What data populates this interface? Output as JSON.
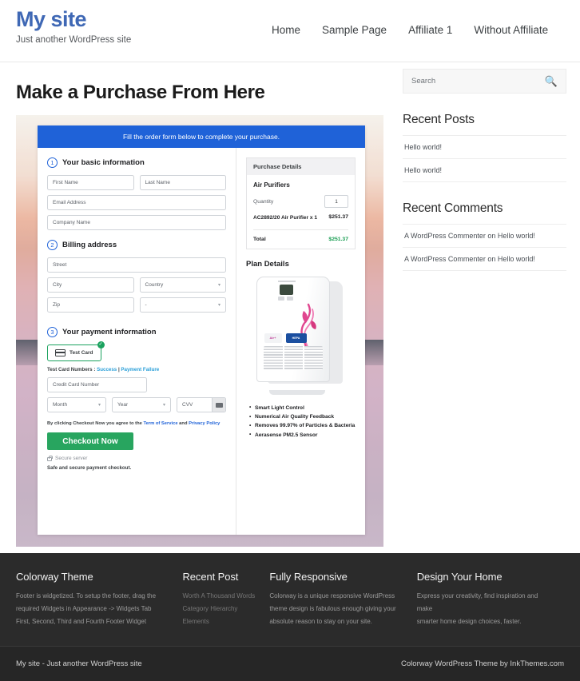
{
  "header": {
    "site_title": "My site",
    "tagline": "Just another WordPress site",
    "nav": [
      {
        "label": "Home"
      },
      {
        "label": "Sample Page"
      },
      {
        "label": "Affiliate 1"
      },
      {
        "label": "Without Affiliate"
      }
    ]
  },
  "main": {
    "page_title": "Make a Purchase From Here",
    "form": {
      "banner": "Fill the order form below to complete your purchase.",
      "step1": {
        "number": "1",
        "title": "Your basic information",
        "first_name_placeholder": "First Name",
        "last_name_placeholder": "Last Name",
        "email_placeholder": "Email Address",
        "company_placeholder": "Company Name"
      },
      "step2": {
        "number": "2",
        "title": "Billing address",
        "street_placeholder": "Street",
        "city_placeholder": "City",
        "country_value": "Country",
        "zip_placeholder": "Zip",
        "state_value": "-"
      },
      "step3": {
        "number": "3",
        "title": "Your payment information",
        "card_tab_label": "Test Card",
        "card_tab_check": "✓",
        "test_card_prefix": "Test Card Numbers : ",
        "test_card_success": "Success",
        "test_card_separator": " | ",
        "test_card_failure": "Payment Failure",
        "card_number_placeholder": "Credit Card Number",
        "month_value": "Month",
        "year_value": "Year",
        "cvv_placeholder": "CVV",
        "terms_prefix": "By clicking Checkout Now you agree to the ",
        "terms_link1": "Term of Service",
        "terms_middle": " and ",
        "terms_link2": "Privacy Policy",
        "checkout_label": "Checkout Now",
        "secure_server": "Secure server",
        "safe_text": "Safe and secure payment checkout."
      },
      "purchase_details": {
        "heading": "Purchase Details",
        "product": "Air Purifiers",
        "quantity_label": "Quantity",
        "quantity_value": "1",
        "line_item_name": "AC2892/20 Air Purifier x 1",
        "line_item_amount": "$251.37",
        "total_label": "Total",
        "total_amount": "$251.37"
      },
      "plan_details": {
        "heading": "Plan Details",
        "product_badge_1": "Air+",
        "product_badge_2": "HEPA",
        "features": [
          "Smart Light Control",
          "Numerical Air Quality Feedback",
          "Removes 99.97% of Particles & Bacteria",
          "Aerasense PM2.5 Sensor"
        ]
      }
    }
  },
  "sidebar": {
    "search_placeholder": "Search",
    "search_icon": "search-icon",
    "recent_posts": {
      "title": "Recent Posts",
      "items": [
        "Hello world!",
        "Hello world!"
      ]
    },
    "recent_comments": {
      "title": "Recent Comments",
      "items": [
        "A WordPress Commenter on Hello world!",
        "A WordPress Commenter on Hello world!"
      ]
    }
  },
  "footer": {
    "columns": [
      {
        "title": "Colorway Theme",
        "lines": [
          "Footer is widgetized. To setup the footer, drag the",
          "required Widgets in Appearance -> Widgets Tab",
          "First, Second, Third and Fourth Footer Widget"
        ]
      },
      {
        "title": "Recent Post",
        "lines": [
          "Worth A Thousand Words",
          "Category Hierarchy",
          "Elements"
        ]
      },
      {
        "title": "Fully Responsive",
        "lines": [
          "Colorway is a unique responsive WordPress",
          "theme design is fabulous enough giving your",
          "absolute reason to stay on your site."
        ]
      },
      {
        "title": "Design Your Home",
        "lines": [
          "Express your creativity, find inspiration and make",
          "smarter home design choices, faster."
        ]
      }
    ],
    "bottom_left": "My site - Just another WordPress site",
    "bottom_right": "Colorway WordPress Theme by InkThemes.com"
  },
  "colors": {
    "brand_blue": "#3f68b5",
    "banner_blue": "#1f62d8",
    "checkout_green": "#28a55f",
    "total_green": "#139b4e",
    "footer_dark": "#2b2b2b"
  }
}
